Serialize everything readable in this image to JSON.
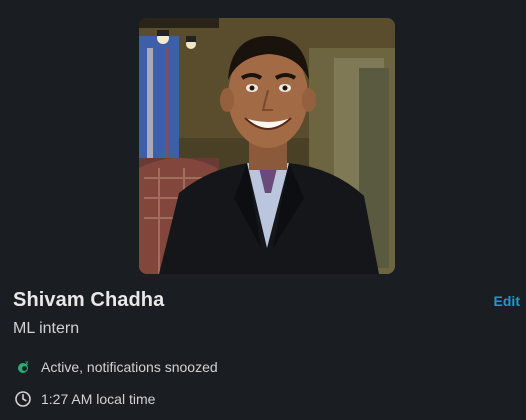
{
  "profile": {
    "name": "Shivam Chadha",
    "title": "ML intern",
    "edit_label": "Edit",
    "status_text": "Active, notifications snoozed",
    "local_time": "1:27 AM local time",
    "status_icon": "snoozed-active-icon",
    "time_icon": "clock-icon"
  },
  "colors": {
    "background": "#1a1d21",
    "accent": "#1d9bd1",
    "active": "#2bac76"
  }
}
